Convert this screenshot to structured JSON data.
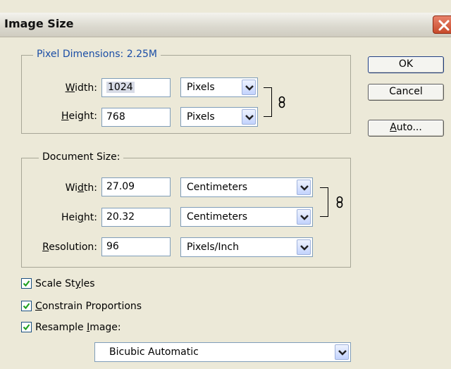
{
  "window": {
    "title": "Image Size"
  },
  "pixel_dimensions": {
    "legend_label": "Pixel Dimensions:",
    "legend_value": "2.25M",
    "width_label_pre": "",
    "width_label_key": "W",
    "width_label_post": "idth:",
    "width_value": "1024",
    "width_unit": "Pixels",
    "height_label_pre": "",
    "height_label_key": "H",
    "height_label_post": "eight:",
    "height_value": "768",
    "height_unit": "Pixels"
  },
  "document_size": {
    "legend": "Document Size:",
    "width_label_pre": "Wi",
    "width_label_key": "d",
    "width_label_post": "th:",
    "width_value": "27.09",
    "width_unit": "Centimeters",
    "height_label_pre": "Hei",
    "height_label_key": "g",
    "height_label_post": "ht:",
    "height_value": "20.32",
    "height_unit": "Centimeters",
    "resolution_label_pre": "",
    "resolution_label_key": "R",
    "resolution_label_post": "esolution:",
    "resolution_value": "96",
    "resolution_unit": "Pixels/Inch"
  },
  "options": {
    "scale_styles_pre": "Scale St",
    "scale_styles_key": "y",
    "scale_styles_post": "les",
    "scale_styles_checked": true,
    "constrain_pre": "",
    "constrain_key": "C",
    "constrain_post": "onstrain Proportions",
    "constrain_checked": true,
    "resample_pre": "Resample ",
    "resample_key": "I",
    "resample_post": "mage:",
    "resample_checked": true,
    "resample_method": "Bicubic Automatic"
  },
  "buttons": {
    "ok": "OK",
    "cancel": "Cancel",
    "auto_key": "A",
    "auto_post": "uto..."
  },
  "colors": {
    "legend_blue": "#1b4ea6",
    "dialog_bg": "#ece9d8",
    "close_red": "#c74a2b"
  }
}
